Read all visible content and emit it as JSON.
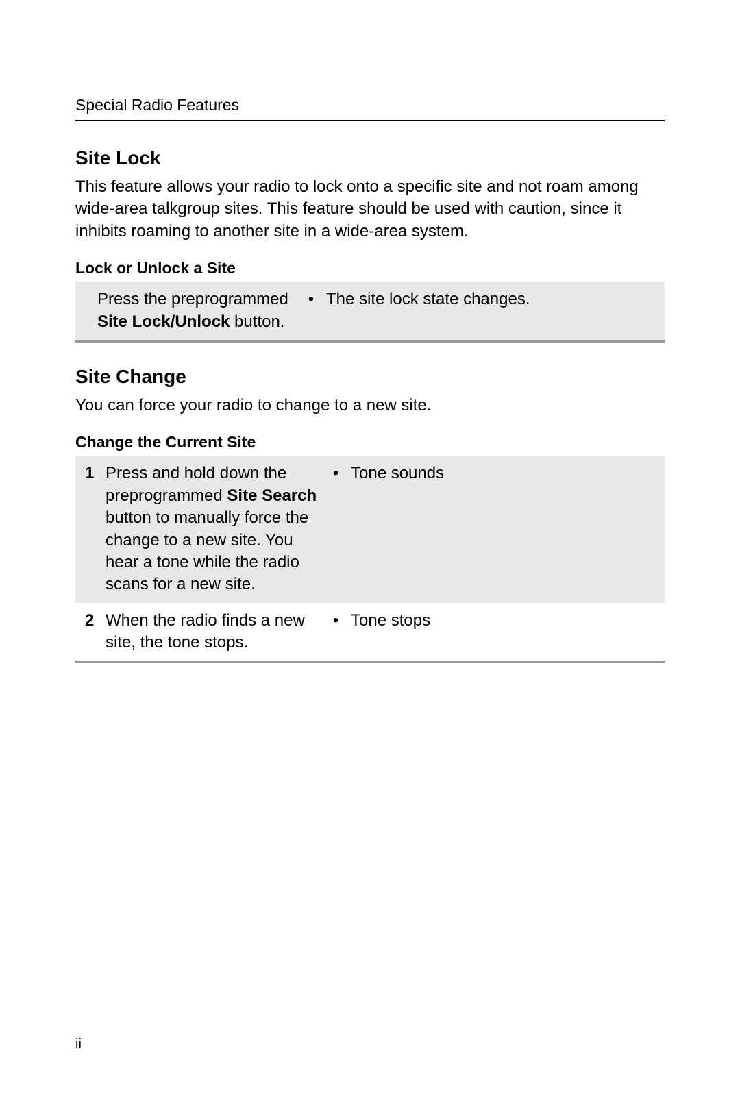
{
  "header": {
    "section_title": "Special Radio Features"
  },
  "site_lock": {
    "heading": "Site Lock",
    "intro": "This feature allows your radio to lock onto a specific site and not roam among wide-area talkgroup sites. This feature should be used with caution, since it inhibits roaming to another site in a wide-area system.",
    "subheading": "Lock or Unlock a Site",
    "action_pre": "Press the preprogrammed ",
    "action_bold": "Site Lock/Unlock",
    "action_post": " button.",
    "result": "The site lock state changes."
  },
  "site_change": {
    "heading": "Site Change",
    "intro": "You can force your radio to change to a new site.",
    "subheading": "Change the Current Site",
    "steps": [
      {
        "num": "1",
        "action_pre": "Press and hold down the preprogrammed ",
        "action_bold": "Site Search",
        "action_post": " button to manually force the change to a new site. You hear a tone while the radio scans for a new site.",
        "result": "Tone sounds"
      },
      {
        "num": "2",
        "action_pre": "When the radio finds a new site, the tone stops.",
        "action_bold": "",
        "action_post": "",
        "result": "Tone stops"
      }
    ]
  },
  "page_number": "ii",
  "bullet": "•"
}
